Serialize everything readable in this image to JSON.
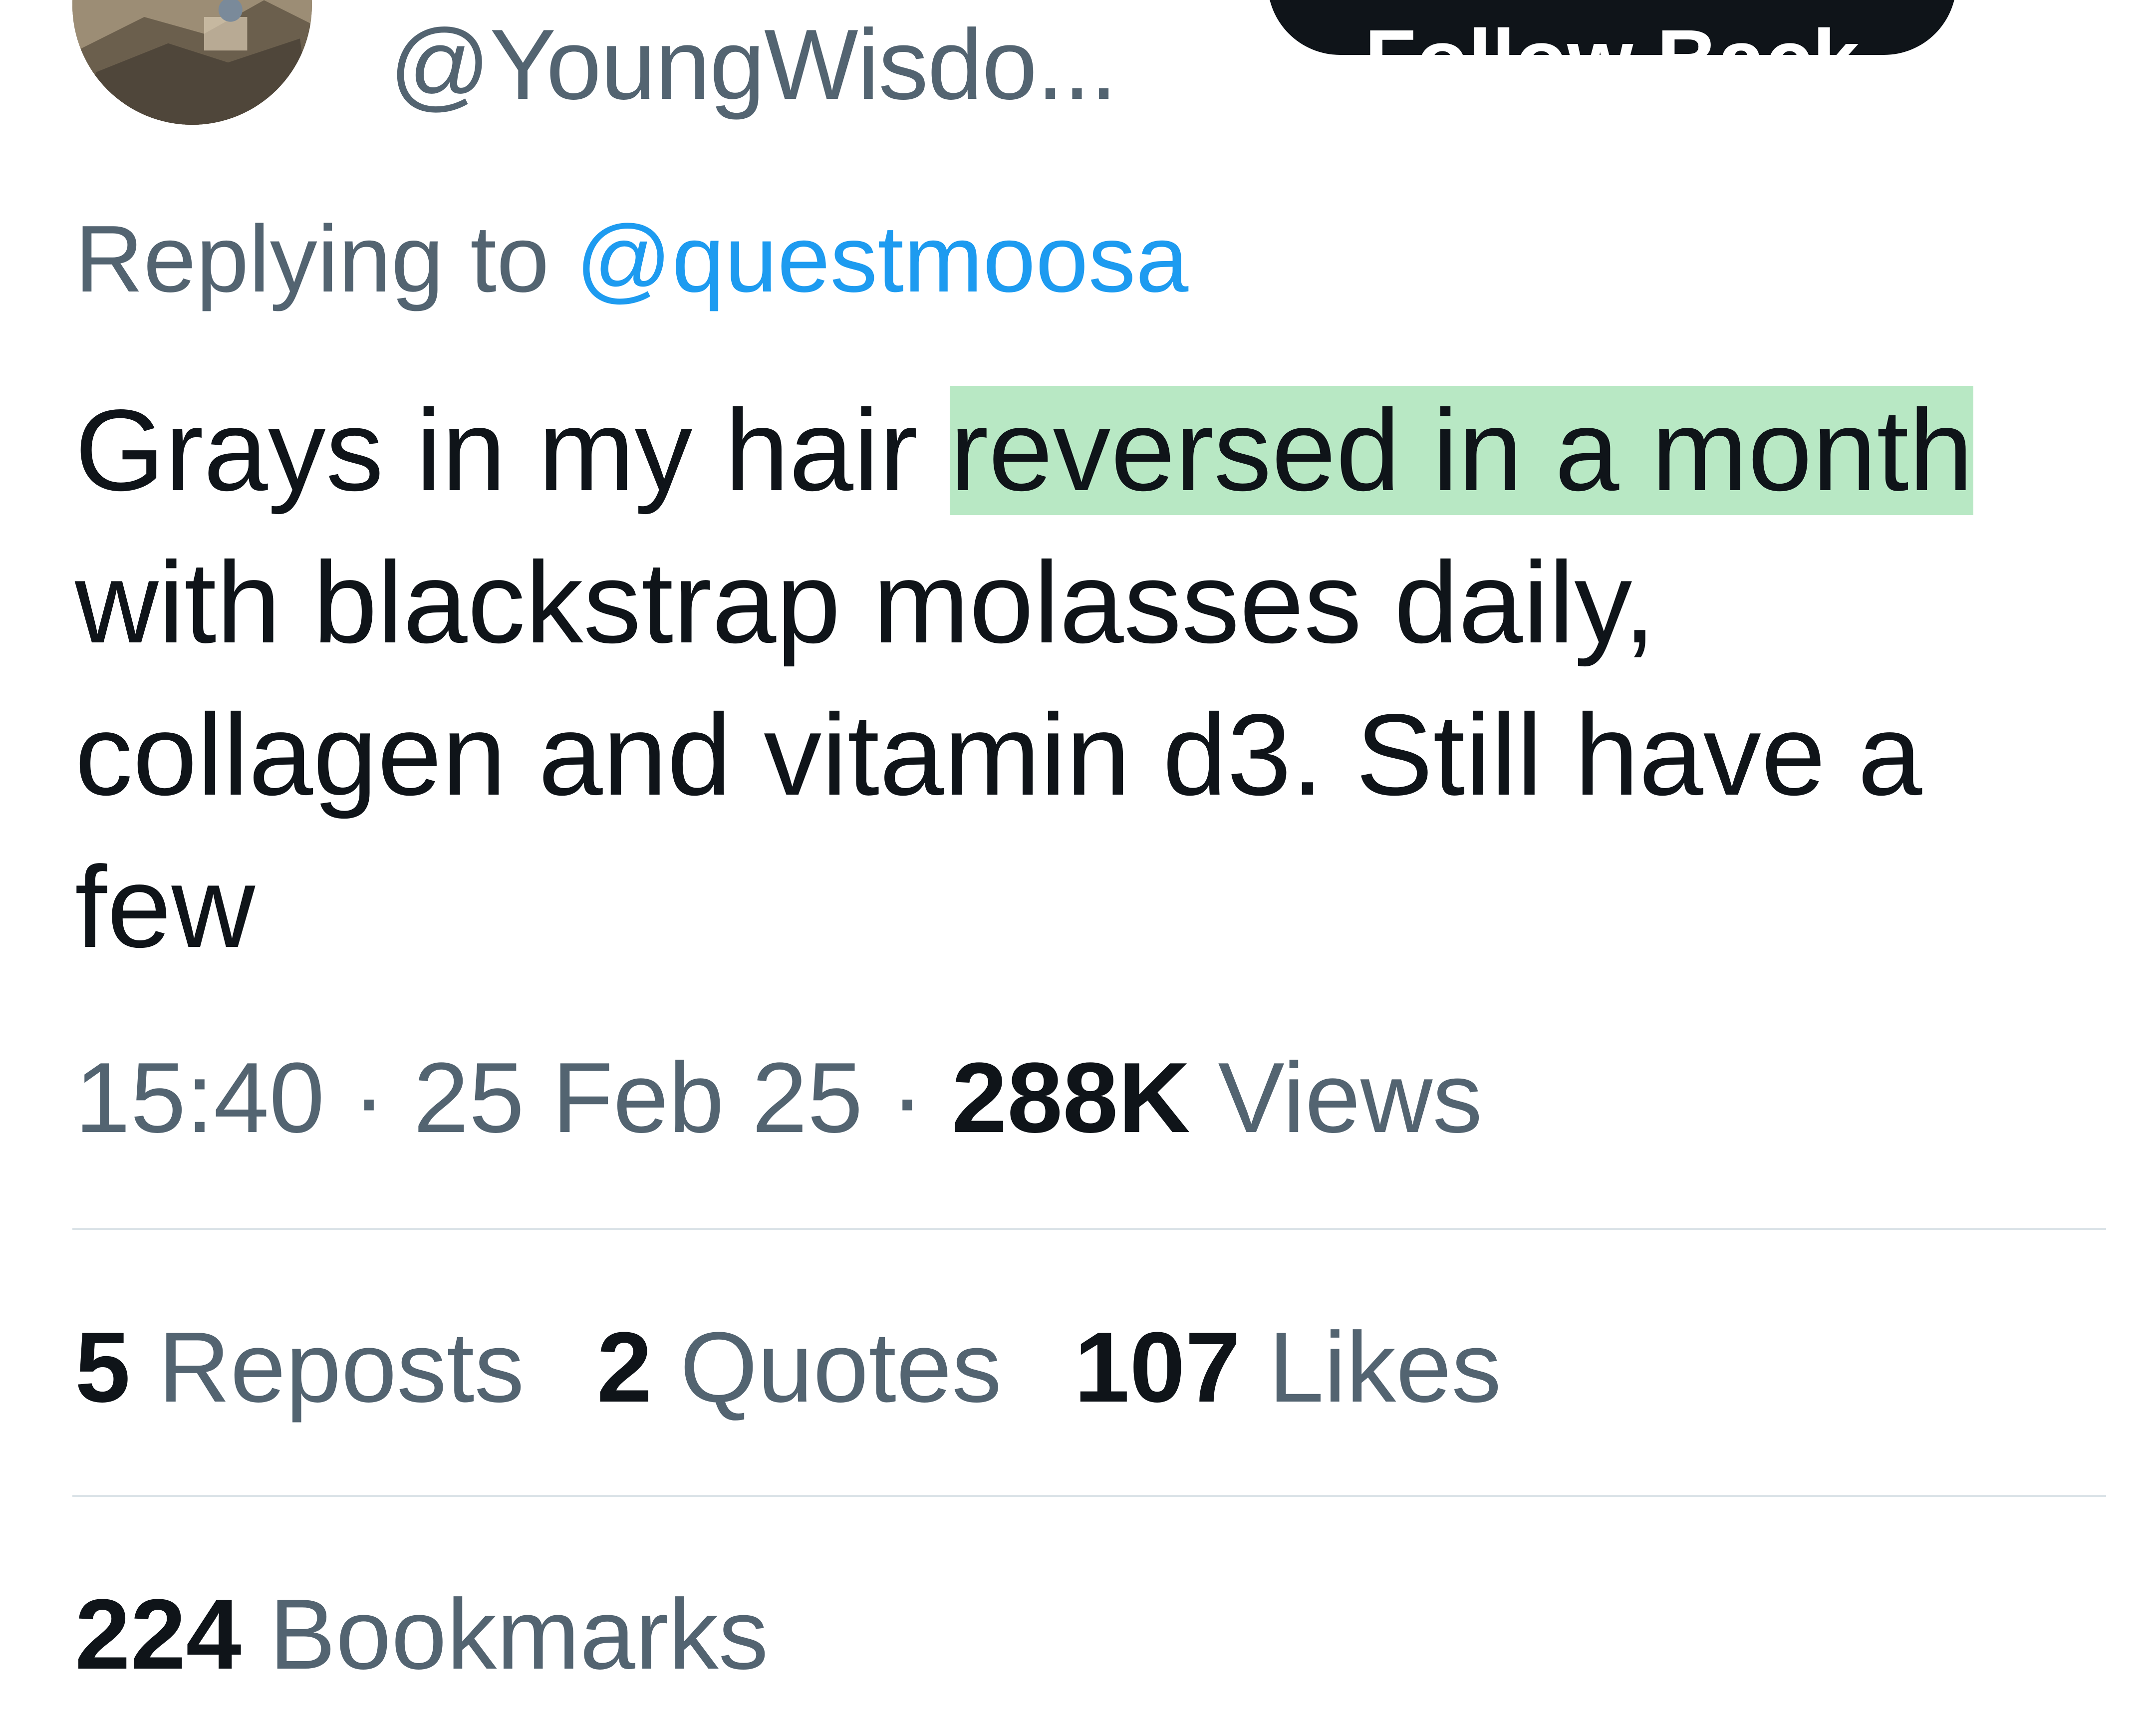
{
  "author": {
    "handle": "@YoungWisdo..."
  },
  "follow_button_label": "Follow Back",
  "reply_context": {
    "prefix": "Replying to",
    "mention": "@questmoosa"
  },
  "tweet": {
    "text_before": "Grays in my hair ",
    "text_highlighted": "reversed in a month",
    "text_after": " with blackstrap molasses daily, collagen and vitamin d3. Still have a few",
    "highlight_color": "#b8e8c4"
  },
  "meta": {
    "time": "15:40",
    "separator": "·",
    "date": "25 Feb 25",
    "views_count": "288K",
    "views_label": "Views"
  },
  "stats": {
    "reposts_count": "5",
    "reposts_label": "Reposts",
    "quotes_count": "2",
    "quotes_label": "Quotes",
    "likes_count": "107",
    "likes_label": "Likes",
    "bookmarks_count": "224",
    "bookmarks_label": "Bookmarks"
  },
  "colors": {
    "text_primary": "#0f1419",
    "text_secondary": "#536471",
    "link": "#1d9bf0",
    "divider": "#dbe3e8"
  }
}
